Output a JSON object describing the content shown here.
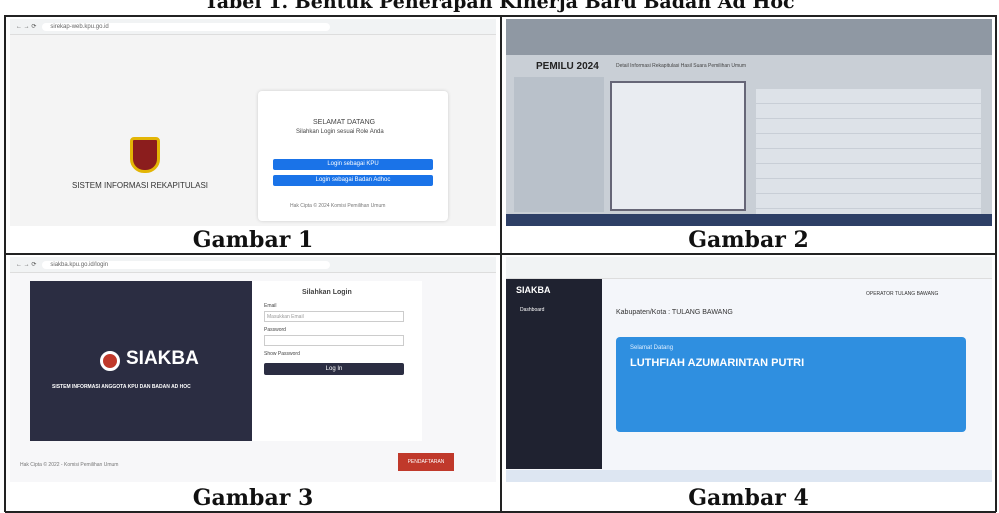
{
  "title": "Tabel 1. Bentuk Penerapan Kinerja Baru Badan Ad Hoc",
  "captions": [
    "Gambar 1",
    "Gambar 2",
    "Gambar 3",
    "Gambar 4"
  ],
  "g1": {
    "url": "sirekap-web.kpu.go.id",
    "welcome": "SELAMAT DATANG",
    "instruction": "Silahkan Login sesuai Role Anda",
    "btn_kpu": "Login sebagai KPU",
    "btn_adhoc": "Login sebagai Badan Adhoc",
    "footer": "Hak Cipta © 2024 Komisi Pemilihan Umum",
    "system_name": "SISTEM INFORMASI REKAPITULASI"
  },
  "g2": {
    "brand": "PEMILU 2024",
    "header": "Detail Informasi Rekapitulasi Hasil Suara Pemilihan Umum"
  },
  "g3": {
    "url": "siakba.kpu.go.id/login",
    "brand": "SIAKBA",
    "subtitle": "SISTEM INFORMASI ANGGOTA KPU DAN BADAN AD HOC",
    "login_title": "Silahkan Login",
    "email_label": "Email",
    "email_placeholder": "Masukkan Email",
    "password_label": "Password",
    "show_password": "Show Password",
    "login_btn": "Log In",
    "footer": "Hak Cipta © 2022 - Komisi Pemilihan Umum",
    "badge": "PENDAFTARAN"
  },
  "g4": {
    "brand": "SIAKBA",
    "menu_dashboard": "Dashboard",
    "kabupaten": "Kabupaten/Kota : TULANG BAWANG",
    "operator": "OPERATOR TULANG BAWANG",
    "greeting": "Selamat Datang",
    "name": "LUTHFIAH AZUMARINTAN PUTRI"
  },
  "colors": {
    "kpu_blue": "#1a73e8",
    "siakba_dark": "#2b2d42",
    "g4_banner": "#2f8fe0"
  }
}
